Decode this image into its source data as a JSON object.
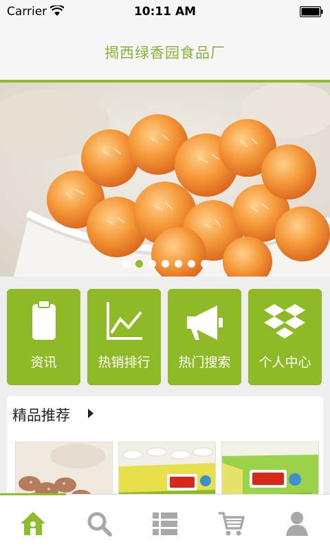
{
  "status_bar": {
    "carrier": "Carrier",
    "time": "10:11 AM"
  },
  "header": {
    "title": "揭西绿香园食品厂"
  },
  "banner": {
    "slide_count": 7,
    "active_slide": 2,
    "image": "candied-kumquat-bowl-photo"
  },
  "tiles": [
    {
      "label": "资讯",
      "icon": "clipboard-icon"
    },
    {
      "label": "热销排行",
      "icon": "line-chart-icon"
    },
    {
      "label": "热门搜索",
      "icon": "megaphone-icon"
    },
    {
      "label": "个人中心",
      "icon": "dropbox-box-icon"
    }
  ],
  "recommend": {
    "title": "精品推荐",
    "items": [
      {
        "image": "dried-fruit-photo"
      },
      {
        "image": "packaged-candy-photo-1"
      },
      {
        "image": "packaged-candy-photo-2"
      }
    ]
  },
  "tabbar": {
    "active_tab": "home",
    "tabs": [
      {
        "icon": "home-icon"
      },
      {
        "icon": "search-icon"
      },
      {
        "icon": "list-icon"
      },
      {
        "icon": "cart-icon"
      },
      {
        "icon": "user-icon"
      }
    ]
  },
  "colors": {
    "accent": "#8fbc2a",
    "title_text": "#86b535",
    "tab_inactive": "#a8a8a8"
  }
}
